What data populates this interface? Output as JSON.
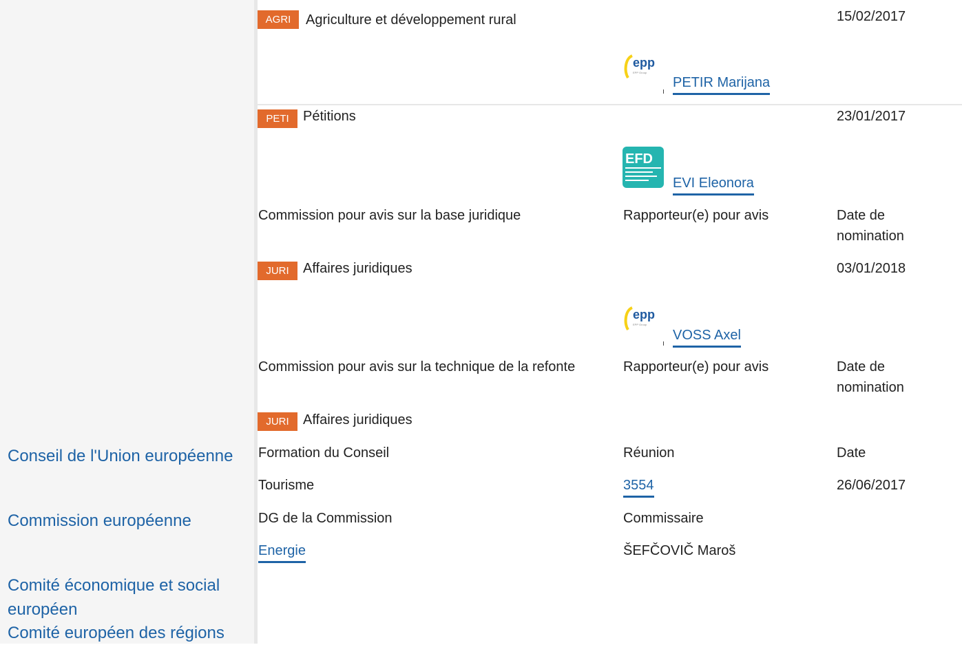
{
  "institutions": {
    "council": "Conseil de l'Union européenne",
    "commission": "Commission européenne",
    "eesc_line1": "Comité économique et social",
    "eesc_line2": "européen",
    "cor": "Comité européen des régions"
  },
  "committees": [
    {
      "badge": "AGRI",
      "name": "Agriculture et développement rural",
      "date": "15/02/2017",
      "rapporteur": "PETIR Marijana",
      "group_logo": "epp-logo"
    },
    {
      "badge": "PETI",
      "name": "Pétitions",
      "date": "23/01/2017",
      "rapporteur": "EVI Eleonora",
      "group_logo": "efdd-logo"
    }
  ],
  "legal_basis": {
    "header": {
      "committee": "Commission pour avis sur la base juridique",
      "rapporteur": "Rapporteur(e) pour avis",
      "date_line1": "Date de",
      "date_line2": "nomination"
    },
    "badge": "JURI",
    "name": "Affaires juridiques",
    "date": "03/01/2018",
    "rapporteur": "VOSS Axel",
    "group_logo": "epp-logo"
  },
  "recast": {
    "header": {
      "committee": "Commission pour avis sur la technique de la refonte",
      "rapporteur": "Rapporteur(e) pour avis",
      "date_line1": "Date de",
      "date_line2": "nomination"
    },
    "badge": "JURI",
    "name": "Affaires juridiques"
  },
  "council": {
    "header": {
      "formation": "Formation du Conseil",
      "meeting": "Réunion",
      "date": "Date"
    },
    "formation": "Tourisme",
    "meeting": "3554",
    "date": "26/06/2017"
  },
  "commission": {
    "header": {
      "dg": "DG de la Commission",
      "commissioner": "Commissaire"
    },
    "dg": "Energie",
    "commissioner": "ŠEFČOVIČ Maroš"
  },
  "logos": {
    "epp_text": "epp",
    "efd_text": "EFD"
  },
  "colors": {
    "accent": "#1e63a6",
    "badge": "#e26a2c"
  }
}
